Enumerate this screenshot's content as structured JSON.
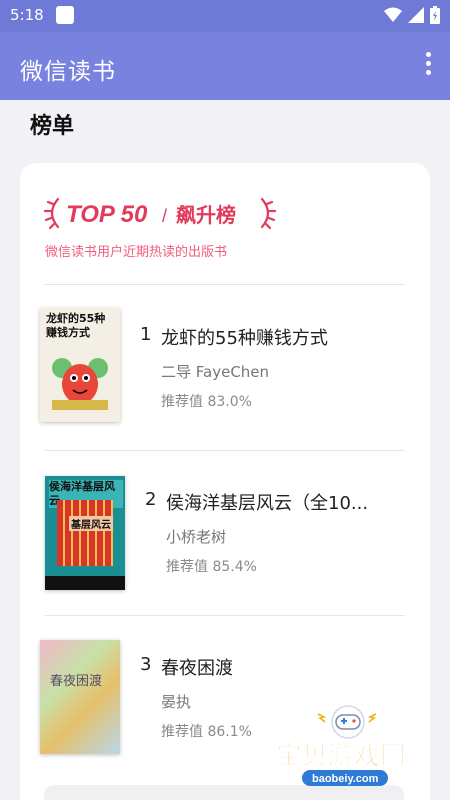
{
  "status_bar": {
    "time": "5:18"
  },
  "app_bar": {
    "title": "微信读书"
  },
  "section_title": "榜单",
  "banner": {
    "top_text": "TOP 50",
    "slash": "/",
    "list_name": "飙升榜",
    "subtitle": "微信读书用户近期热读的出版书"
  },
  "books": [
    {
      "rank": "1",
      "title": "龙虾的55种赚钱方式",
      "author": "二导 FayeChen",
      "score": "推荐值 83.0%",
      "cover_text": "龙虾的55种赚钱方式"
    },
    {
      "rank": "2",
      "title": "侯海洋基层风云（全10...",
      "author": "小桥老树",
      "score": "推荐值 85.4%",
      "cover_text": "侯海洋基层风云",
      "cover_badge": "基层风云"
    },
    {
      "rank": "3",
      "title": "春夜困渡",
      "author": "晏执",
      "score": "推荐值 86.1%",
      "cover_text": "春夜困渡"
    }
  ],
  "watermark": {
    "brand": "宝贝游戏网",
    "url": "baobeiy.com"
  }
}
